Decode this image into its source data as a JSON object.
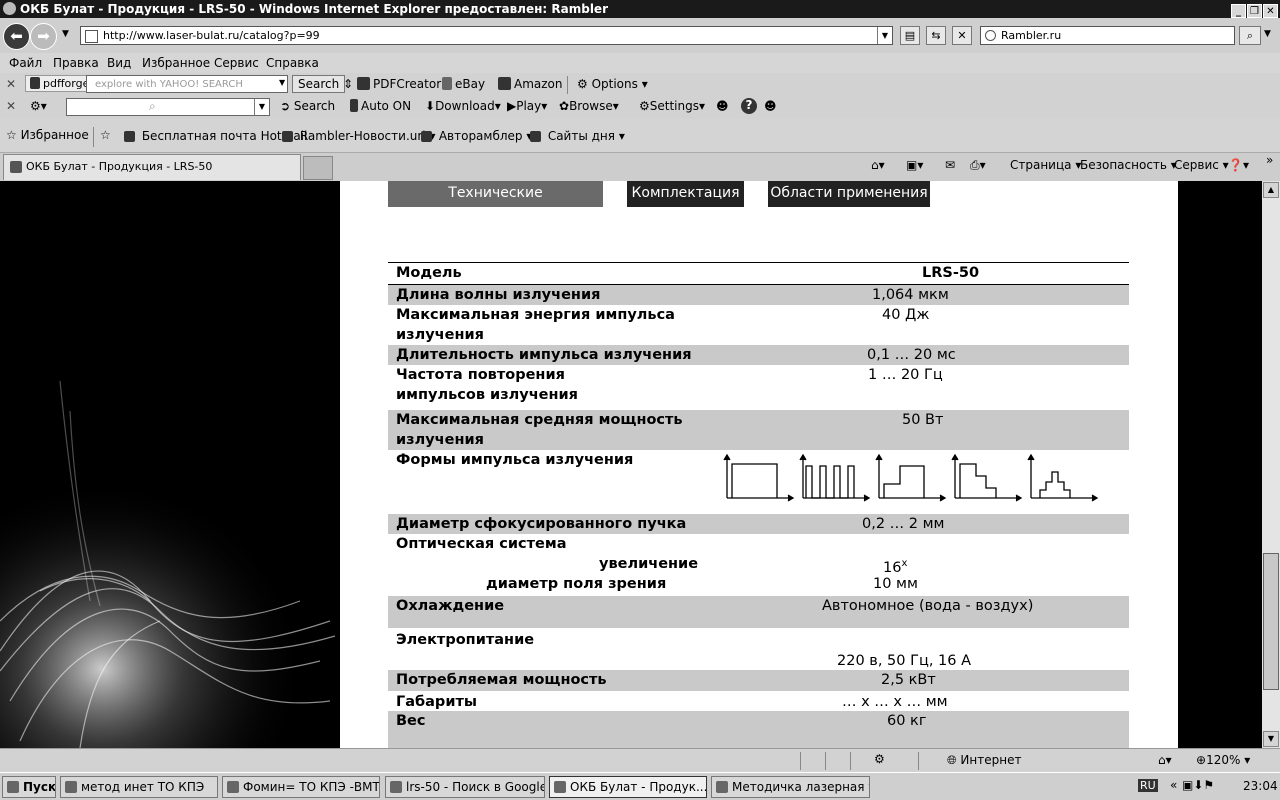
{
  "window": {
    "title": "ОКБ Булат - Продукция - LRS-50 - Windows Internet Explorer предоставлен: Rambler"
  },
  "address": {
    "url": "http://www.laser-bulat.ru/catalog?p=99",
    "search_text": "Rambler.ru"
  },
  "menu": [
    "Файл",
    "Правка",
    "Вид",
    "Избранное",
    "Сервис",
    "Справка"
  ],
  "toolbar1": {
    "brand": "pdfforge",
    "yahoo_placeholder": "explore with YAHOO! SEARCH",
    "search_label": "Search",
    "pdfcreator": "PDFCreator",
    "ebay": "eBay",
    "amazon": "Amazon",
    "options": "Options"
  },
  "toolbar2": {
    "search": "Search",
    "auto_on": "Auto ON",
    "download": "Download",
    "play": "Play",
    "browse": "Browse",
    "settings": "Settings"
  },
  "favorites": {
    "label": "Избранное",
    "items": [
      "Бесплатная почта Hotmail",
      "Rambler-Новости.url",
      "Авторамблер",
      "Сайты дня"
    ]
  },
  "tab": {
    "title": "ОКБ Булат - Продукция - LRS-50"
  },
  "commands": [
    "Страница",
    "Безопасность",
    "Сервис"
  ],
  "page_tabs": [
    "Технические характеристики",
    "Комплектация",
    "Области применения"
  ],
  "spec": {
    "header": {
      "label": "Модель",
      "value": "LRS-50"
    },
    "wavelength": {
      "label": "Длина волны излучения",
      "value": "1,064 мкм"
    },
    "max_energy": {
      "label1": "Максимальная энергия импульса",
      "label2": "излучения",
      "value": "40 Дж"
    },
    "duration": {
      "label": "Длительность импульса излучения",
      "value": "0,1 … 20 мс"
    },
    "frequency": {
      "label1": "Частота повторения",
      "label2": "импульсов излучения",
      "value": "1 … 20 Гц"
    },
    "avg_power": {
      "label1": "Максимальная средняя мощность",
      "label2": "излучения",
      "value": "50 Вт"
    },
    "pulse_forms": {
      "label": "Формы импульса излучения"
    },
    "beam_diameter": {
      "label": "Диаметр сфокусированного пучка",
      "value": "0,2 … 2 мм"
    },
    "optics": {
      "label": "Оптическая система",
      "zoom_label": "увеличение",
      "zoom_value": "16",
      "zoom_sup": "x",
      "field_label": "диаметр поля зрения",
      "field_value": "10 мм"
    },
    "cooling": {
      "label": "Охлаждение",
      "value": "Автономное (вода - воздух)"
    },
    "power_supply": {
      "label": "Электропитание",
      "value": "220 в, 50 Гц, 16 А"
    },
    "consumption": {
      "label": "Потребляемая мощность",
      "value": "2,5 кВт"
    },
    "dimensions": {
      "label": "Габариты",
      "value": "… x … x … мм"
    },
    "weight": {
      "label": "Вес",
      "value": "60 кг"
    }
  },
  "status": {
    "zone": "Интернет",
    "zoom": "120%"
  },
  "taskbar": {
    "start": "Пуск",
    "tasks": [
      "метод инет ТО КПЭ",
      "Фомин= ТО КПЭ -ВМТ-",
      "lrs-50 - Поиск в Google - ...",
      "ОКБ Булат - Продук...",
      "Методичка лазерная ус..."
    ],
    "lang": "RU",
    "clock": "23:04"
  }
}
